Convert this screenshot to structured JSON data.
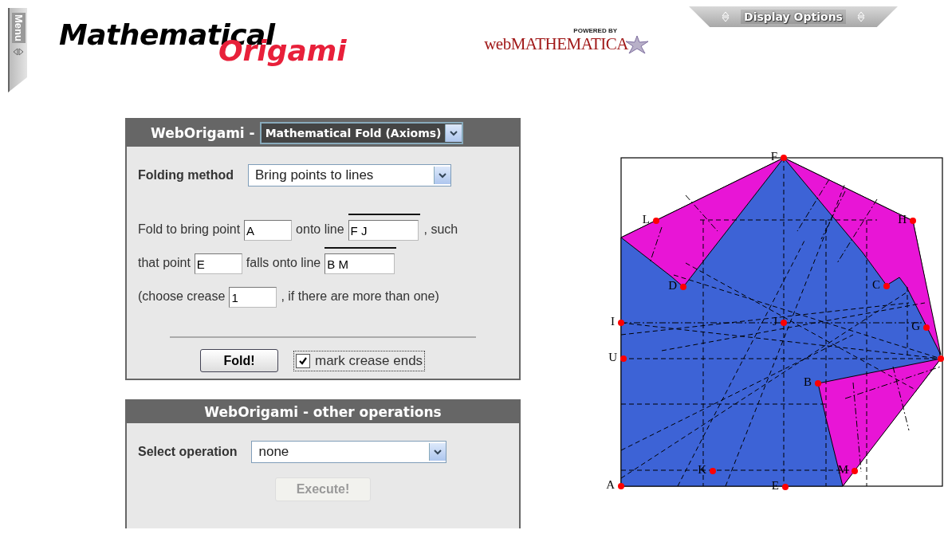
{
  "header": {
    "menu_tab": "Menu",
    "logo": {
      "line1": "Mathematical",
      "line2": "Origami"
    },
    "powered_by": {
      "small": "POWERED BY",
      "name": "webMATHEMATICA"
    },
    "display_options": "Display Options"
  },
  "fold_panel": {
    "title": "WebOrigami -",
    "mode": "Mathematical Fold (Axioms)",
    "method_label": "Folding method",
    "method": "Bring points to lines",
    "rows": [
      {
        "parts": [
          {
            "kind": "text",
            "text": "Fold to bring point"
          },
          {
            "kind": "input",
            "value": "A",
            "overline": false
          },
          {
            "kind": "text",
            "text": "onto line"
          },
          {
            "kind": "input",
            "value": "F J",
            "overline": true
          },
          {
            "kind": "text",
            "text": ", such"
          }
        ]
      },
      {
        "parts": [
          {
            "kind": "text",
            "text": "that point"
          },
          {
            "kind": "input",
            "value": "E",
            "overline": false
          },
          {
            "kind": "text",
            "text": "falls onto line"
          },
          {
            "kind": "input",
            "value": "B M",
            "overline": true
          }
        ]
      },
      {
        "parts": [
          {
            "kind": "text",
            "text": "(choose crease"
          },
          {
            "kind": "input",
            "value": "1",
            "overline": false
          },
          {
            "kind": "text",
            "text": ", if there are more than one)"
          }
        ]
      }
    ],
    "fold_button": "Fold!",
    "checkbox": {
      "label": "mark crease ends",
      "checked": true
    }
  },
  "other_panel": {
    "title": "WebOrigami - other operations",
    "label": "Select operation",
    "operation": "none",
    "button": {
      "label": "Execute!",
      "disabled": true
    }
  },
  "diagram": {
    "points": [
      {
        "label": "F"
      },
      {
        "label": "L"
      },
      {
        "label": "H"
      },
      {
        "label": "D"
      },
      {
        "label": "C"
      },
      {
        "label": "I"
      },
      {
        "label": "J"
      },
      {
        "label": "G"
      },
      {
        "label": "U"
      },
      {
        "label": "B"
      },
      {
        "label": "K"
      },
      {
        "label": "M"
      },
      {
        "label": "A"
      },
      {
        "label": "E"
      }
    ]
  }
}
